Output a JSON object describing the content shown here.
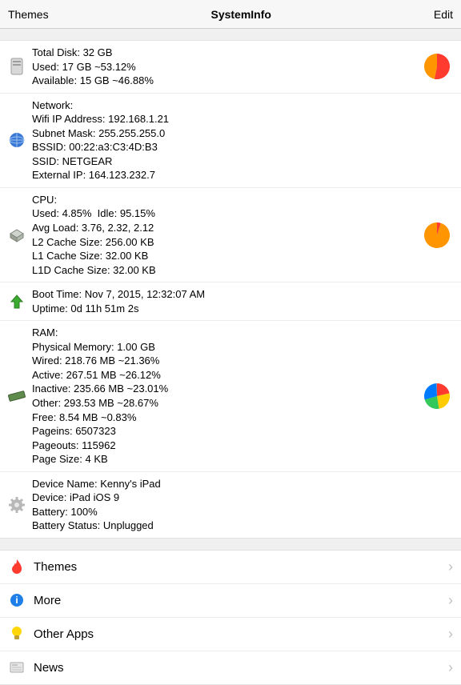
{
  "nav": {
    "left": "Themes",
    "title": "SystemInfo",
    "right": "Edit"
  },
  "disk": {
    "lines": [
      "Total Disk: 32 GB",
      "Used: 17 GB ~53.12%",
      "Available: 15 GB ~46.88%"
    ]
  },
  "network": {
    "lines": [
      "Network:",
      "Wifi IP Address: 192.168.1.21",
      "Subnet Mask: 255.255.255.0",
      "BSSID: 00:22:a3:C3:4D:B3",
      "SSID: NETGEAR",
      "External IP: 164.123.232.7"
    ]
  },
  "cpu": {
    "lines": [
      "CPU:",
      "Used: 4.85%  Idle: 95.15%",
      "Avg Load: 3.76, 2.32, 2.12",
      "L2 Cache Size: 256.00 KB",
      "L1 Cache Size: 32.00 KB",
      "L1D Cache Size: 32.00 KB"
    ]
  },
  "uptime": {
    "lines": [
      "Boot Time: Nov 7, 2015, 12:32:07 AM",
      "Uptime: 0d 11h 51m 2s"
    ]
  },
  "ram": {
    "lines": [
      "RAM:",
      "Physical Memory: 1.00 GB",
      "Wired: 218.76 MB ~21.36%",
      "Active: 267.51 MB ~26.12%",
      "Inactive: 235.66 MB ~23.01%",
      "Other: 293.53 MB ~28.67%",
      "Free: 8.54 MB ~0.83%",
      "Pageins: 6507323",
      "Pageouts: 115962",
      "Page Size: 4 KB"
    ]
  },
  "device": {
    "lines": [
      "Device Name: Kenny's iPad",
      "Device: iPad iOS 9",
      "Battery: 100%",
      "Battery Status: Unplugged"
    ]
  },
  "menu": {
    "themes": "Themes",
    "more": "More",
    "otherApps": "Other Apps",
    "news": "News"
  },
  "chart_data": [
    {
      "type": "pie",
      "title": "Disk",
      "series": [
        {
          "name": "Used",
          "value": 53.12,
          "color": "#ff3b30"
        },
        {
          "name": "Available",
          "value": 46.88,
          "color": "#ff9500"
        }
      ]
    },
    {
      "type": "pie",
      "title": "CPU",
      "series": [
        {
          "name": "Used",
          "value": 4.85,
          "color": "#ff3b30"
        },
        {
          "name": "Idle",
          "value": 95.15,
          "color": "#ff9500"
        }
      ]
    },
    {
      "type": "pie",
      "title": "RAM",
      "series": [
        {
          "name": "Wired",
          "value": 21.36,
          "color": "#ff3b30"
        },
        {
          "name": "Active",
          "value": 26.12,
          "color": "#ffcc00"
        },
        {
          "name": "Inactive",
          "value": 23.01,
          "color": "#34c759"
        },
        {
          "name": "Other",
          "value": 28.67,
          "color": "#007aff"
        },
        {
          "name": "Free",
          "value": 0.83,
          "color": "#8e8e93"
        }
      ]
    }
  ]
}
